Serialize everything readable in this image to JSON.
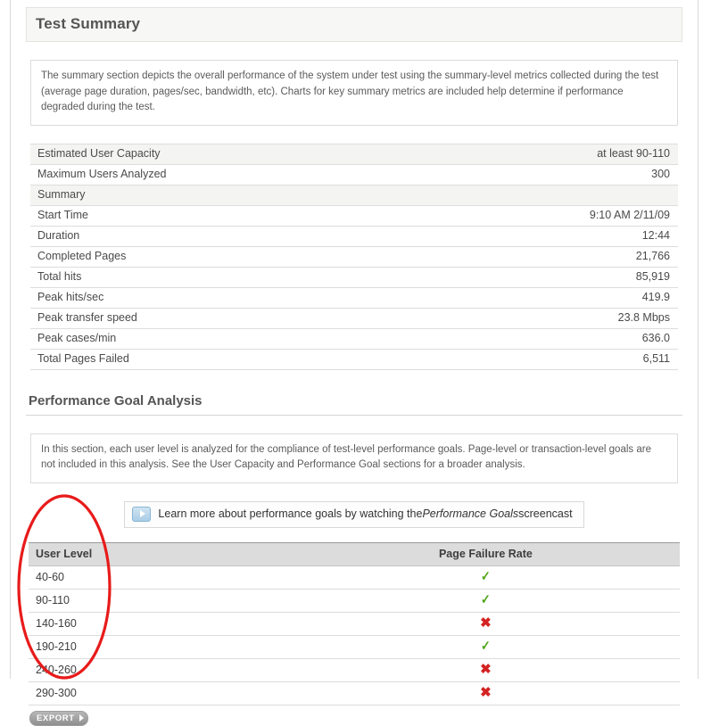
{
  "test_summary": {
    "title": "Test Summary",
    "description": "The summary section depicts the overall performance of the system under test using the summary-level metrics collected during the test (average page duration, pages/sec, bandwidth, etc). Charts for key summary metrics are included help determine if performance degraded during the test.",
    "rows": [
      {
        "label": "Estimated User Capacity",
        "value": "at least 90-110",
        "shaded": true
      },
      {
        "label": "Maximum Users Analyzed",
        "value": "300",
        "shaded": false
      },
      {
        "label": "Summary",
        "value": "",
        "shaded": true
      },
      {
        "label": "Start Time",
        "value": "9:10 AM 2/11/09",
        "shaded": false
      },
      {
        "label": "Duration",
        "value": "12:44",
        "shaded": false
      },
      {
        "label": "Completed Pages",
        "value": "21,766",
        "shaded": false
      },
      {
        "label": "Total hits",
        "value": "85,919",
        "shaded": false
      },
      {
        "label": "Peak hits/sec",
        "value": "419.9",
        "shaded": false
      },
      {
        "label": "Peak transfer speed",
        "value": "23.8 Mbps",
        "shaded": false
      },
      {
        "label": "Peak cases/min",
        "value": "636.0",
        "shaded": false
      },
      {
        "label": "Total Pages Failed",
        "value": "6,511",
        "shaded": false
      }
    ]
  },
  "performance_goal_analysis": {
    "title": "Performance Goal Analysis",
    "description": "In this section, each user level is analyzed for the compliance of test-level performance goals. Page-level or transaction-level goals are not included in this analysis. See the User Capacity and Performance Goal sections for a broader analysis.",
    "learn_more": {
      "icon": "play-icon",
      "text_before": "Learn more about performance goals by watching the ",
      "emphasis": "Performance Goals",
      "text_after": " screencast"
    },
    "table": {
      "columns": [
        "User Level",
        "Page Failure Rate"
      ],
      "rows": [
        {
          "user_level": "40-60",
          "page_failure_rate": "pass",
          "mark": "✓"
        },
        {
          "user_level": "90-110",
          "page_failure_rate": "pass",
          "mark": "✓"
        },
        {
          "user_level": "140-160",
          "page_failure_rate": "fail",
          "mark": "✖"
        },
        {
          "user_level": "190-210",
          "page_failure_rate": "pass",
          "mark": "✓"
        },
        {
          "user_level": "240-260",
          "page_failure_rate": "fail",
          "mark": "✖"
        },
        {
          "user_level": "290-300",
          "page_failure_rate": "fail",
          "mark": "✖"
        }
      ]
    },
    "export_button": "EXPORT"
  },
  "annotation": {
    "shape": "ellipse",
    "color": "#e81b1b",
    "target": "user-level-column"
  },
  "colors": {
    "pass": "#4ea515",
    "fail": "#d42222",
    "header_bg": "#dcdcdc",
    "shaded_row": "#f4f4f2",
    "annotation": "#e81b1b"
  }
}
